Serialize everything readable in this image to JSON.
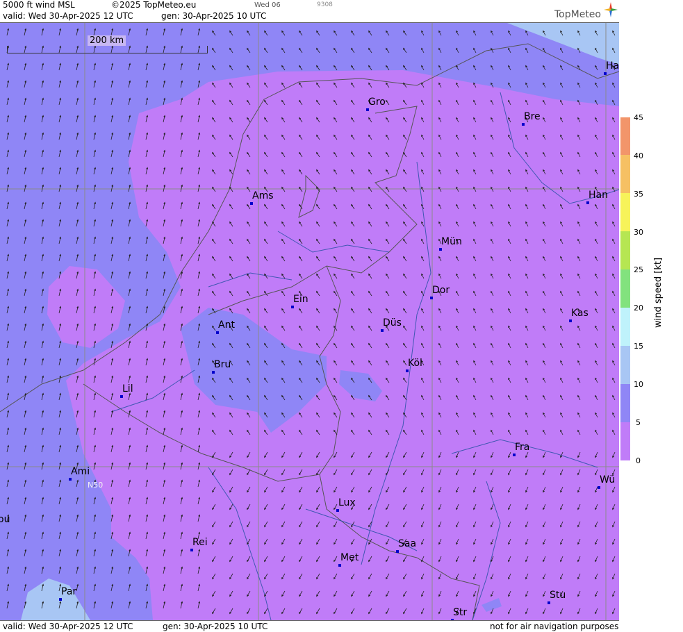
{
  "header": {
    "title": "5000 ft wind MSL",
    "copyright": "©2025 TopMeteo.eu",
    "day_marker": "Wed 06",
    "code": "9308",
    "valid": "valid:  Wed  30-Apr-2025  12 UTC",
    "generated": "gen: 30-Apr-2025 10 UTC",
    "logo": "TopMeteo"
  },
  "footer": {
    "valid": "valid:  Wed  30-Apr-2025  12 UTC",
    "generated": "gen: 30-Apr-2025 10 UTC",
    "note": "not for air navigation purposes"
  },
  "map": {
    "scale_label": "200 km",
    "latitude_label": "N50",
    "cities": [
      {
        "name": "Gro"
      },
      {
        "name": "Bre"
      },
      {
        "name": "Ha"
      },
      {
        "name": "Ams"
      },
      {
        "name": "Han"
      },
      {
        "name": "Mün"
      },
      {
        "name": "Dor"
      },
      {
        "name": "Ein"
      },
      {
        "name": "Ant"
      },
      {
        "name": "Düs"
      },
      {
        "name": "Kas"
      },
      {
        "name": "Bru"
      },
      {
        "name": "Köl"
      },
      {
        "name": "Lil"
      },
      {
        "name": "Fra"
      },
      {
        "name": "Ami"
      },
      {
        "name": "Wü"
      },
      {
        "name": "Lux"
      },
      {
        "name": "ou"
      },
      {
        "name": "Rei"
      },
      {
        "name": "Saa"
      },
      {
        "name": "Met"
      },
      {
        "name": "Par"
      },
      {
        "name": "Stu"
      },
      {
        "name": "Str"
      }
    ]
  },
  "legend": {
    "title": "wind speed [kt]",
    "ticks": [
      "45",
      "40",
      "35",
      "30",
      "25",
      "20",
      "15",
      "10",
      "5",
      "0"
    ],
    "colors": [
      "#c07cf8",
      "#8f86f6",
      "#a8c6f4",
      "#bff2fb",
      "#82e27e",
      "#b6e652",
      "#f7f35a",
      "#f6c063",
      "#f2956a",
      "#ef7468"
    ]
  }
}
